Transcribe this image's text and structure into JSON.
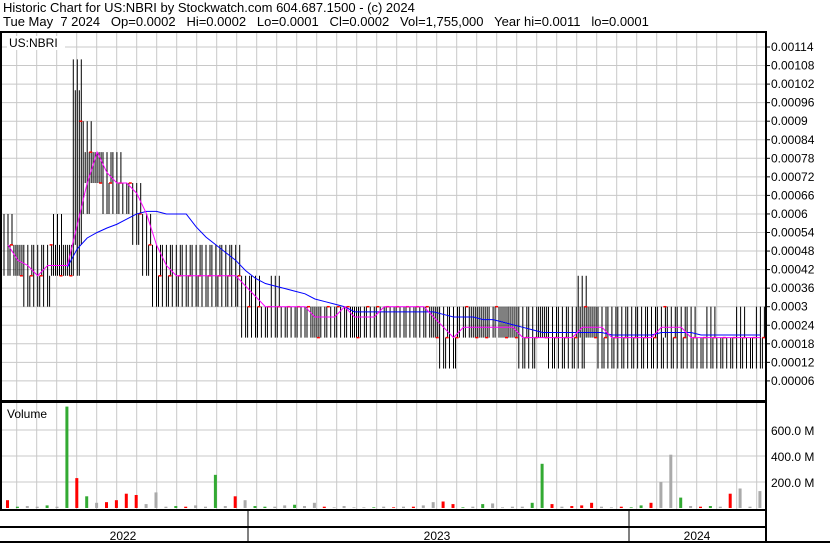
{
  "header": {
    "title": "Historic Chart for US:NBRI by Stockwatch.com 604.687.1500 - (c) 2024",
    "quote": "Tue May  7 2024   Op=0.0002   Hi=0.0002   Lo=0.0001   Cl=0.0002   Vol=1,755,000   Year hi=0.0011   lo=0.0001"
  },
  "chart_data": {
    "type": "bar",
    "symbol_label": "US:NBRI",
    "volume_label": "Volume",
    "price_ticks": [
      "0.00114",
      "0.00108",
      "0.00102",
      "0.00096",
      "0.0009",
      "0.00084",
      "0.00078",
      "0.00072",
      "0.00066",
      "0.0006",
      "0.00054",
      "0.00048",
      "0.00042",
      "0.00036",
      "0.0003",
      "0.00024",
      "0.00018",
      "0.00012",
      "0.00006"
    ],
    "price_tick_values": [
      0.00114,
      0.00108,
      0.00102,
      0.00096,
      0.0009,
      0.00084,
      0.00078,
      0.00072,
      0.00066,
      0.0006,
      0.00054,
      0.00048,
      0.00042,
      0.00036,
      0.0003,
      0.00024,
      0.00018,
      0.00012,
      6e-05
    ],
    "volume_ticks": [
      "600.0 M",
      "400.0 M",
      "200.0 M"
    ],
    "volume_tick_values": [
      600,
      400,
      200
    ],
    "years": [
      "2022",
      "2023",
      "2024"
    ],
    "hi": [
      0.0006,
      0.0005,
      0.0005,
      0.0005,
      0.0005,
      0.0006,
      0.0005,
      0.0011,
      0.0009,
      0.0008,
      0.0008,
      0.0008,
      0.0007,
      0.0007,
      0.0006,
      0.0005,
      0.0005,
      0.0005,
      0.0005,
      0.0005,
      0.0005,
      0.0005,
      0.0005,
      0.0005,
      0.0004,
      0.0004,
      0.0003,
      0.0004,
      0.0003,
      0.0003,
      0.0003,
      0.0003,
      0.0003,
      0.0003,
      0.0003,
      0.0003,
      0.0003,
      0.0003,
      0.0003,
      0.0003,
      0.0003,
      0.0003,
      0.0003,
      0.0003,
      0.0003,
      0.0003,
      0.0003,
      0.0003,
      0.0003,
      0.0003,
      0.0003,
      0.0003,
      0.0003,
      0.0003,
      0.0003,
      0.0003,
      0.0003,
      0.0003,
      0.0004,
      0.0003,
      0.0003,
      0.0003,
      0.0003,
      0.0003,
      0.0003,
      0.0003,
      0.0003,
      0.0003,
      0.0003,
      0.0003,
      0.0002,
      0.0003,
      0.0002,
      0.0002,
      0.0003,
      0.0002,
      0.0003
    ],
    "lo": [
      0.0004,
      0.0004,
      0.0003,
      0.0003,
      0.0003,
      0.0004,
      0.0004,
      0.0004,
      0.0006,
      0.0007,
      0.0006,
      0.0006,
      0.0006,
      0.0005,
      0.0004,
      0.0003,
      0.0003,
      0.0003,
      0.0003,
      0.0003,
      0.0003,
      0.0003,
      0.0003,
      0.0003,
      0.0002,
      0.0002,
      0.0002,
      0.0002,
      0.0002,
      0.0002,
      0.0002,
      0.0002,
      0.0002,
      0.0002,
      0.0002,
      0.0002,
      0.0002,
      0.0002,
      0.0002,
      0.0002,
      0.0002,
      0.0002,
      0.0002,
      0.0002,
      0.0001,
      0.0001,
      0.0002,
      0.0002,
      0.0002,
      0.0002,
      0.0002,
      0.0002,
      0.0001,
      0.0001,
      0.0002,
      0.0001,
      0.0001,
      0.0001,
      0.0001,
      0.0002,
      0.0001,
      0.0001,
      0.0001,
      0.0001,
      0.0001,
      0.0001,
      0.0001,
      0.0001,
      0.0001,
      0.0001,
      0.0001,
      0.0001,
      0.0001,
      0.0001,
      0.0001,
      0.0001,
      0.0001
    ],
    "close": [
      0.0005,
      0.0004,
      0.0004,
      0.0004,
      0.0005,
      0.0004,
      0.0004,
      0.0009,
      0.0008,
      0.0007,
      0.0007,
      0.0007,
      0.0007,
      0.0006,
      0.0005,
      0.0004,
      0.0004,
      0.0004,
      0.0004,
      0.0004,
      0.0004,
      0.0004,
      0.0004,
      0.0004,
      0.0003,
      0.0003,
      0.0003,
      0.0003,
      0.0003,
      0.0003,
      0.0003,
      0.0002,
      0.0003,
      0.0003,
      0.0003,
      0.0002,
      0.0003,
      0.0003,
      0.0003,
      0.0003,
      0.0003,
      0.0003,
      0.0003,
      0.0002,
      0.0002,
      0.0002,
      0.0003,
      0.0002,
      0.0002,
      0.0003,
      0.0002,
      0.0002,
      0.0002,
      0.0002,
      0.0002,
      0.0002,
      0.0002,
      0.0002,
      0.0003,
      0.0002,
      0.0002,
      0.0002,
      0.0002,
      0.0002,
      0.0002,
      0.0002,
      0.0003,
      0.0002,
      0.0002,
      0.0002,
      0.0002,
      0.0002,
      0.0002,
      0.0002,
      0.0002,
      0.0002,
      0.0002
    ],
    "volume_millions": [
      60,
      10,
      15,
      10,
      20,
      10,
      780,
      230,
      90,
      40,
      45,
      60,
      110,
      100,
      30,
      120,
      10,
      15,
      10,
      20,
      10,
      255,
      15,
      90,
      60,
      15,
      10,
      10,
      20,
      25,
      15,
      40,
      10,
      5,
      15,
      5,
      5,
      5,
      10,
      5,
      10,
      10,
      20,
      45,
      50,
      30,
      5,
      10,
      30,
      35,
      5,
      10,
      10,
      40,
      340,
      30,
      10,
      15,
      20,
      40,
      10,
      5,
      10,
      5,
      20,
      40,
      200,
      410,
      80,
      15,
      10,
      15,
      10,
      110,
      150,
      10,
      130
    ],
    "volume_dir": [
      "d",
      "u",
      "n",
      "n",
      "u",
      "n",
      "u",
      "d",
      "u",
      "n",
      "d",
      "d",
      "d",
      "d",
      "n",
      "n",
      "n",
      "u",
      "d",
      "n",
      "n",
      "u",
      "n",
      "d",
      "n",
      "u",
      "u",
      "n",
      "n",
      "u",
      "n",
      "n",
      "d",
      "n",
      "n",
      "n",
      "n",
      "u",
      "n",
      "d",
      "n",
      "d",
      "n",
      "n",
      "d",
      "d",
      "u",
      "n",
      "u",
      "n",
      "n",
      "n",
      "n",
      "u",
      "u",
      "d",
      "n",
      "d",
      "d",
      "d",
      "n",
      "n",
      "d",
      "u",
      "u",
      "d",
      "n",
      "n",
      "u",
      "n",
      "d",
      "u",
      "n",
      "d",
      "n",
      "n",
      "n"
    ],
    "colors": {
      "bar": "#000000",
      "close_tick": "#ff0000",
      "ma_short": "#ff00ff",
      "ma_long": "#0000ff",
      "vol_up": "#33aa33",
      "vol_down": "#ff0000",
      "vol_flat": "#aaaaaa",
      "grid": "#c8c8c8"
    }
  }
}
